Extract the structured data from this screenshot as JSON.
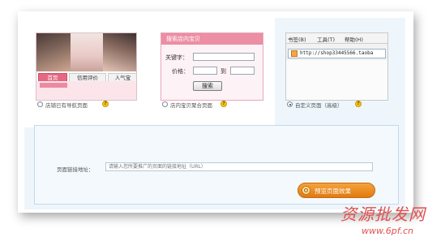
{
  "thumb1": {
    "tabs": [
      "首页",
      "信用评价",
      "人气宝"
    ]
  },
  "thumb2": {
    "header": "搜索店内宝贝",
    "keyword_label": "关键字：",
    "price_label": "价格：",
    "to_label": "到",
    "search_button": "搜索"
  },
  "thumb3": {
    "menu": [
      "书签(B)",
      "工具(T)",
      "帮助(H)"
    ],
    "address": "http://shop33445566.taoba"
  },
  "options": [
    {
      "label": "店铺已有导航页面",
      "checked": false
    },
    {
      "label": "店内宝贝聚合页面",
      "checked": false
    },
    {
      "label": "自定义页面（高级）",
      "checked": true
    }
  ],
  "help_glyph": "?",
  "form": {
    "url_label": "页面链接地址：",
    "url_placeholder": "请输入您所要推广的页面的链接地址（URL）",
    "preview_button": "预览页面效果"
  },
  "watermark": {
    "cn": "资源批发网",
    "url": "www.6pf.cn"
  },
  "colors": {
    "accent_orange": "#e07a12",
    "pink_header": "#ec8ea4",
    "panel_blue": "#eef6fc"
  }
}
